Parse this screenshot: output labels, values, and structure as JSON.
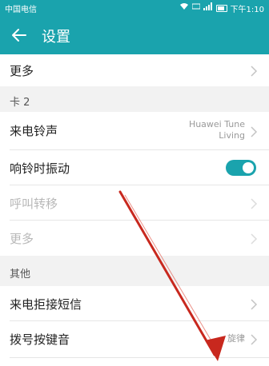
{
  "status_bar": {
    "carrier": "中国电信",
    "time": "下午1:10",
    "icons": [
      "wifi-icon",
      "hd-icon",
      "signal-icon",
      "battery-icon"
    ]
  },
  "app_bar": {
    "title": "设置",
    "back_icon": "back-arrow-icon"
  },
  "rows": [
    {
      "label": "更多",
      "type": "nav",
      "enabled": true
    },
    {
      "section": "卡 2"
    },
    {
      "label": "来电铃声",
      "type": "nav",
      "value_line1": "Huawei Tune",
      "value_line2": "Living",
      "enabled": true
    },
    {
      "label": "响铃时振动",
      "type": "toggle",
      "checked": true,
      "enabled": true
    },
    {
      "label": "呼叫转移",
      "type": "nav",
      "enabled": false
    },
    {
      "label": "更多",
      "type": "nav",
      "enabled": false
    },
    {
      "section": "其他"
    },
    {
      "label": "来电拒接短信",
      "type": "nav",
      "enabled": true
    },
    {
      "label": "拨号按键音",
      "type": "nav",
      "value_line1": "旋律",
      "enabled": true
    }
  ],
  "colors": {
    "accent": "#1aa3ad",
    "annotation_arrow": "#c8281e"
  }
}
